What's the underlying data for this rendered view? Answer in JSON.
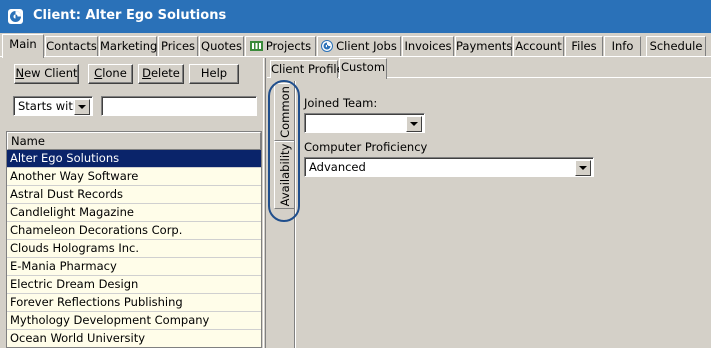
{
  "window": {
    "title": "Client: Alter Ego Solutions",
    "app_icon": "app-logo-icon"
  },
  "main_tabs": [
    {
      "label": "Main",
      "active": true
    },
    {
      "label": "Contacts"
    },
    {
      "label": "Marketing"
    },
    {
      "label": "Prices"
    },
    {
      "label": "Quotes"
    },
    {
      "label": "Projects",
      "icon": "projects-icon"
    },
    {
      "label": "Client Jobs",
      "icon": "client-jobs-icon"
    },
    {
      "label": "Invoices"
    },
    {
      "label": "Payments"
    },
    {
      "label": "Account"
    },
    {
      "label": "Files"
    },
    {
      "label": "Info"
    },
    {
      "label": "Schedule"
    }
  ],
  "toolbar": {
    "new_client": {
      "hotkey": "N",
      "rest": "ew Client"
    },
    "clone": {
      "hotkey": "C",
      "rest": "lone"
    },
    "delete": {
      "hotkey": "D",
      "rest": "elete"
    },
    "help": "Help"
  },
  "search": {
    "filter_mode": "Starts with",
    "query": ""
  },
  "client_list": {
    "column_header": "Name",
    "selected_index": 0,
    "rows": [
      "Alter Ego Solutions",
      "Another Way Software",
      "Astral Dust Records",
      "Candlelight Magazine",
      "Chameleon Decorations Corp.",
      "Clouds Holograms Inc.",
      "E-Mania Pharmacy",
      "Electric Dream Design",
      "Forever Reflections Publishing",
      "Mythology Development Company",
      "Ocean World University"
    ]
  },
  "sub_tabs": [
    {
      "label": "Client Profile"
    },
    {
      "label": "Custom",
      "active": true
    }
  ],
  "vertical_tabs": [
    {
      "label": "Common",
      "active": true
    },
    {
      "label": "Availability"
    }
  ],
  "custom_fields": {
    "joined_team": {
      "label": "Joined Team:",
      "value": ""
    },
    "computer_proficiency": {
      "label": "Computer Proficiency",
      "value": "Advanced"
    }
  },
  "colors": {
    "titlebar": "#2a71b8",
    "selection": "#0a246a",
    "list_background": "#fffde9",
    "highlight_oval": "#1f4e8c"
  }
}
